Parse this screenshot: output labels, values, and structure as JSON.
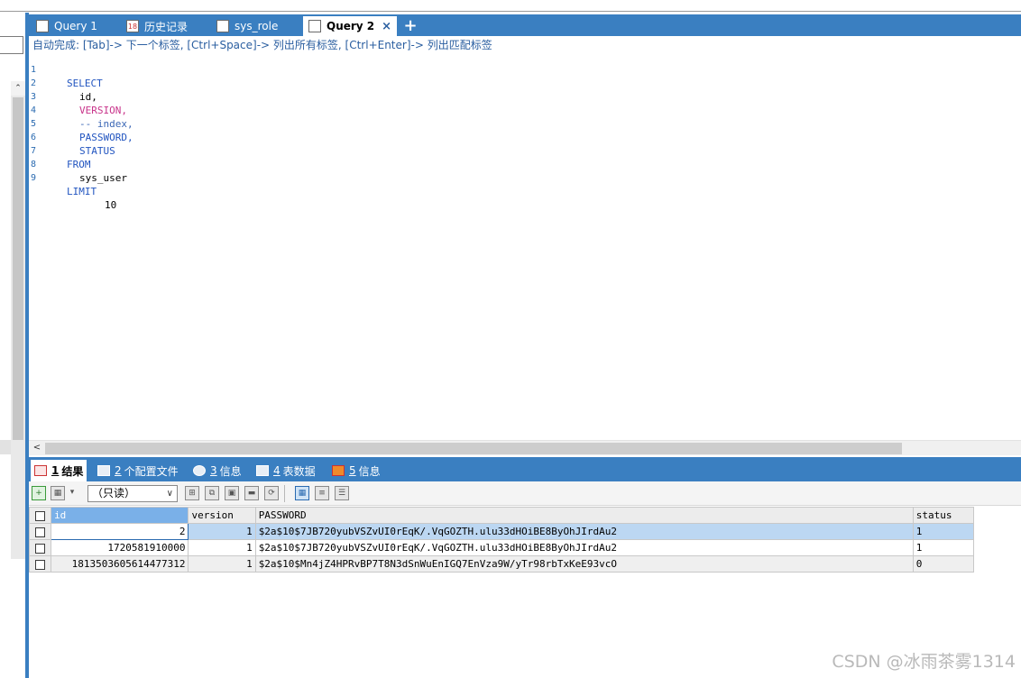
{
  "tabs": [
    {
      "label": "Query 1",
      "icon": "query-icon",
      "active": false
    },
    {
      "label": "历史记录",
      "icon": "calendar-icon",
      "badge": "18",
      "active": false
    },
    {
      "label": "sys_role",
      "icon": "table-edit-icon",
      "active": false
    },
    {
      "label": "Query 2",
      "icon": "query-icon",
      "active": true
    }
  ],
  "new_tab_label": "+",
  "close_label": "×",
  "editor": {
    "autocomplete_hint": "自动完成: [Tab]-> 下一个标签, [Ctrl+Space]-> 列出所有标签, [Ctrl+Enter]-> 列出匹配标签",
    "lines": [
      {
        "n": "1",
        "text": "SELECT"
      },
      {
        "n": "2",
        "text": "id,"
      },
      {
        "n": "3",
        "text": "VERSION,"
      },
      {
        "n": "4",
        "text": "-- index,"
      },
      {
        "n": "5",
        "text": "PASSWORD,"
      },
      {
        "n": "6",
        "text": "STATUS"
      },
      {
        "n": "7",
        "text": "FROM"
      },
      {
        "n": "8",
        "text": "sys_user"
      },
      {
        "n": "9",
        "text": "LIMIT",
        "suffix": "10"
      }
    ]
  },
  "result_tabs": [
    {
      "num": "1",
      "label": "结果",
      "active": true
    },
    {
      "num": "2",
      "label": "个配置文件",
      "active": false
    },
    {
      "num": "3",
      "label": "信息",
      "active": false
    },
    {
      "num": "4",
      "label": "表数据",
      "active": false
    },
    {
      "num": "5",
      "label": "信息",
      "active": false
    }
  ],
  "toolbar": {
    "mode_select": "（只读）"
  },
  "grid": {
    "columns": [
      "id",
      "version",
      "PASSWORD",
      "status"
    ],
    "rows": [
      [
        "2",
        "1",
        "$2a$10$7JB720yubVSZvUI0rEqK/.VqGOZTH.ulu33dHOiBE8ByOhJIrdAu2",
        "1"
      ],
      [
        "1720581910000",
        "1",
        "$2a$10$7JB720yubVSZvUI0rEqK/.VqGOZTH.ulu33dHOiBE8ByOhJIrdAu2",
        "1"
      ],
      [
        "1813503605614477312",
        "1",
        "$2a$10$Mn4jZ4HPRvBP7T8N3dSnWuEnIGQ7EnVza9W/yTr98rbTxKeE93vcO",
        "0"
      ]
    ]
  },
  "watermark": "CSDN @冰雨茶雾1314",
  "colors": {
    "accent": "#3a7fc1",
    "keyword": "#2255c0",
    "magenta_keyword": "#c8338a"
  }
}
